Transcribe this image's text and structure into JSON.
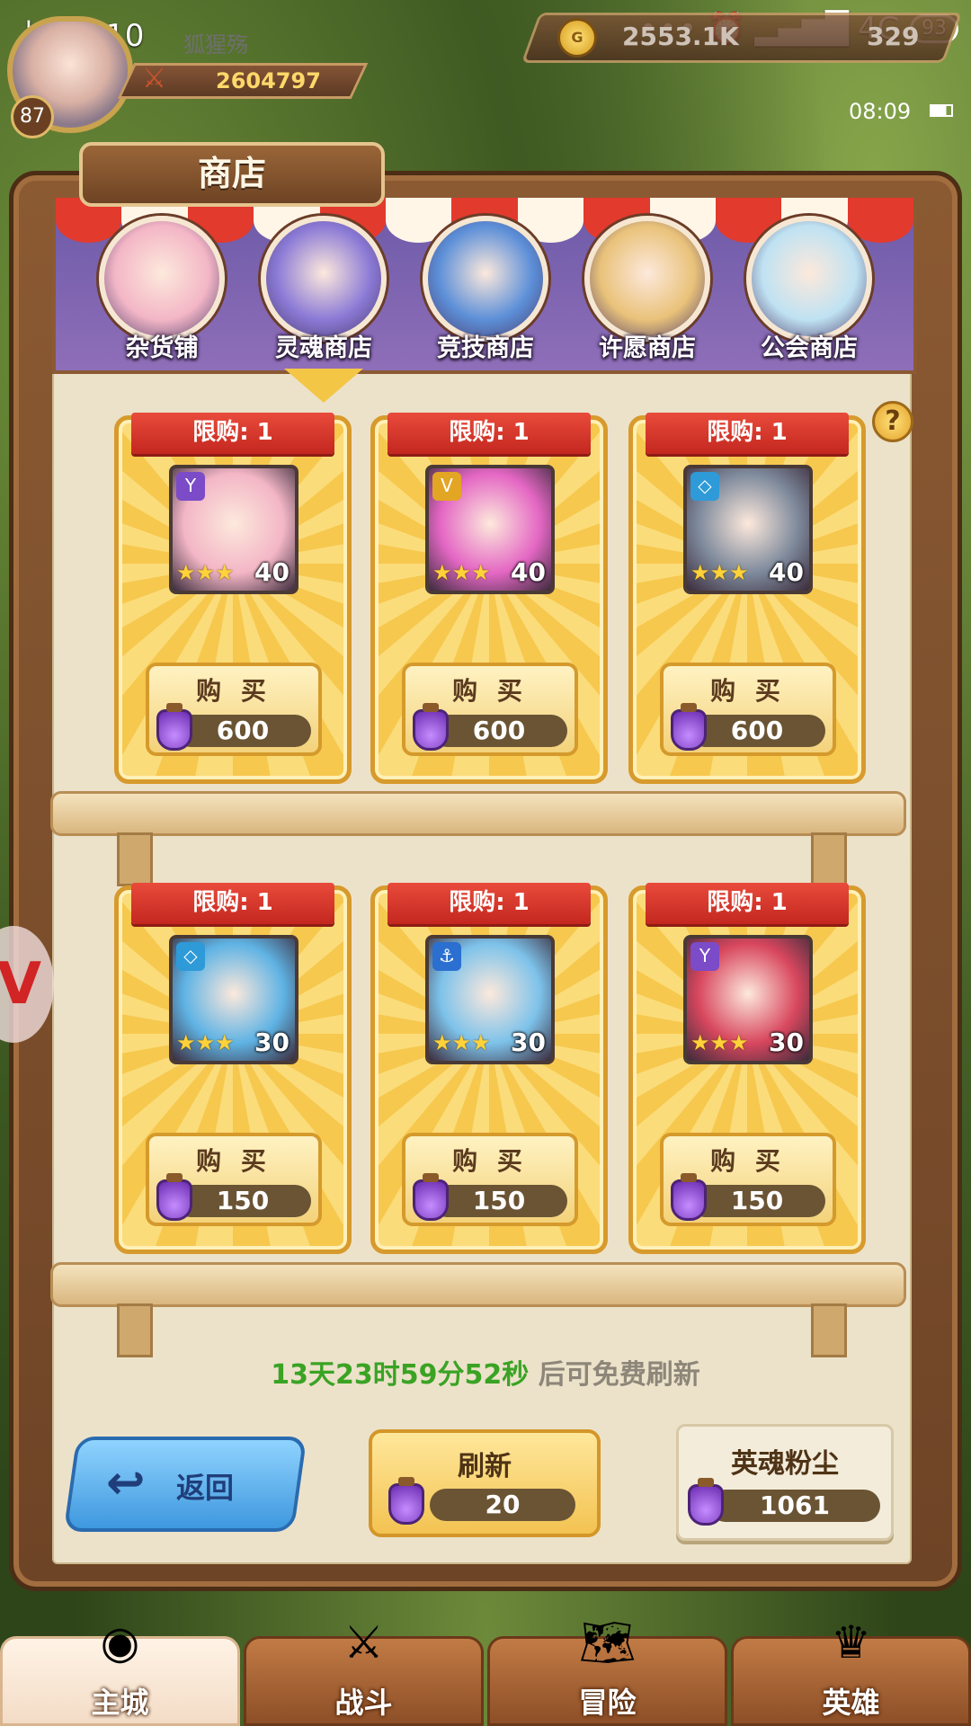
{
  "status_bar": {
    "time": "上午8:10",
    "network": "4G",
    "battery": "93",
    "dots": "•••"
  },
  "player": {
    "level": "87",
    "name": "狐猩殇",
    "power": "2604797"
  },
  "currency": {
    "gold": "2553.1K",
    "gems": "329",
    "coin_symbol": "G"
  },
  "game_clock": "08:09",
  "shop": {
    "title": "商店",
    "help": "?",
    "tabs": [
      {
        "label": "杂货铺",
        "color": "#f3b6c6"
      },
      {
        "label": "灵魂商店",
        "color": "#8b7ad6"
      },
      {
        "label": "竞技商店",
        "color": "#5c8fd8"
      },
      {
        "label": "许愿商店",
        "color": "#e9c27a"
      },
      {
        "label": "公会商店",
        "color": "#bfe2f2"
      }
    ],
    "selected_tab": "灵魂商店",
    "items": [
      {
        "limit": "限购: 1",
        "level": "40",
        "stars": "★★★",
        "faction": "Y",
        "faction_color": "#7b4bc8",
        "portrait": "#f3b6c6",
        "buy": "购 买",
        "price": "600"
      },
      {
        "limit": "限购: 1",
        "level": "40",
        "stars": "★★★",
        "faction": "V",
        "faction_color": "#e3a524",
        "portrait": "#e467c4",
        "buy": "购 买",
        "price": "600"
      },
      {
        "limit": "限购: 1",
        "level": "40",
        "stars": "★★★",
        "faction": "◇",
        "faction_color": "#2e9ad8",
        "portrait": "#7e8a9c",
        "buy": "购 买",
        "price": "600"
      },
      {
        "limit": "限购: 1",
        "level": "30",
        "stars": "★★★",
        "faction": "◇",
        "faction_color": "#2e9ad8",
        "portrait": "#5fb3e4",
        "buy": "购 买",
        "price": "150"
      },
      {
        "limit": "限购: 1",
        "level": "30",
        "stars": "★★★",
        "faction": "⚓",
        "faction_color": "#2b6fd0",
        "portrait": "#7dc2ea",
        "buy": "购 买",
        "price": "150"
      },
      {
        "limit": "限购: 1",
        "level": "30",
        "stars": "★★★",
        "faction": "Y",
        "faction_color": "#7b4bc8",
        "portrait": "#d8475e",
        "buy": "购 买",
        "price": "150"
      }
    ],
    "timer": {
      "countdown": "13天23时59分52秒",
      "suffix": "后可免费刷新"
    },
    "back": {
      "label": "返回",
      "arrow": "↩"
    },
    "refresh": {
      "label": "刷新",
      "price": "20"
    },
    "dust": {
      "label": "英魂粉尘",
      "amount": "1061"
    }
  },
  "side_tab": "V",
  "nav": [
    {
      "label": "主城",
      "icon": "castle-icon",
      "glyph": "◉",
      "active": true
    },
    {
      "label": "战斗",
      "icon": "crossed-swords-icon",
      "glyph": "⚔",
      "active": false
    },
    {
      "label": "冒险",
      "icon": "map-scroll-icon",
      "glyph": "🗺",
      "active": false
    },
    {
      "label": "英雄",
      "icon": "hero-crest-icon",
      "glyph": "♛",
      "active": false
    }
  ]
}
